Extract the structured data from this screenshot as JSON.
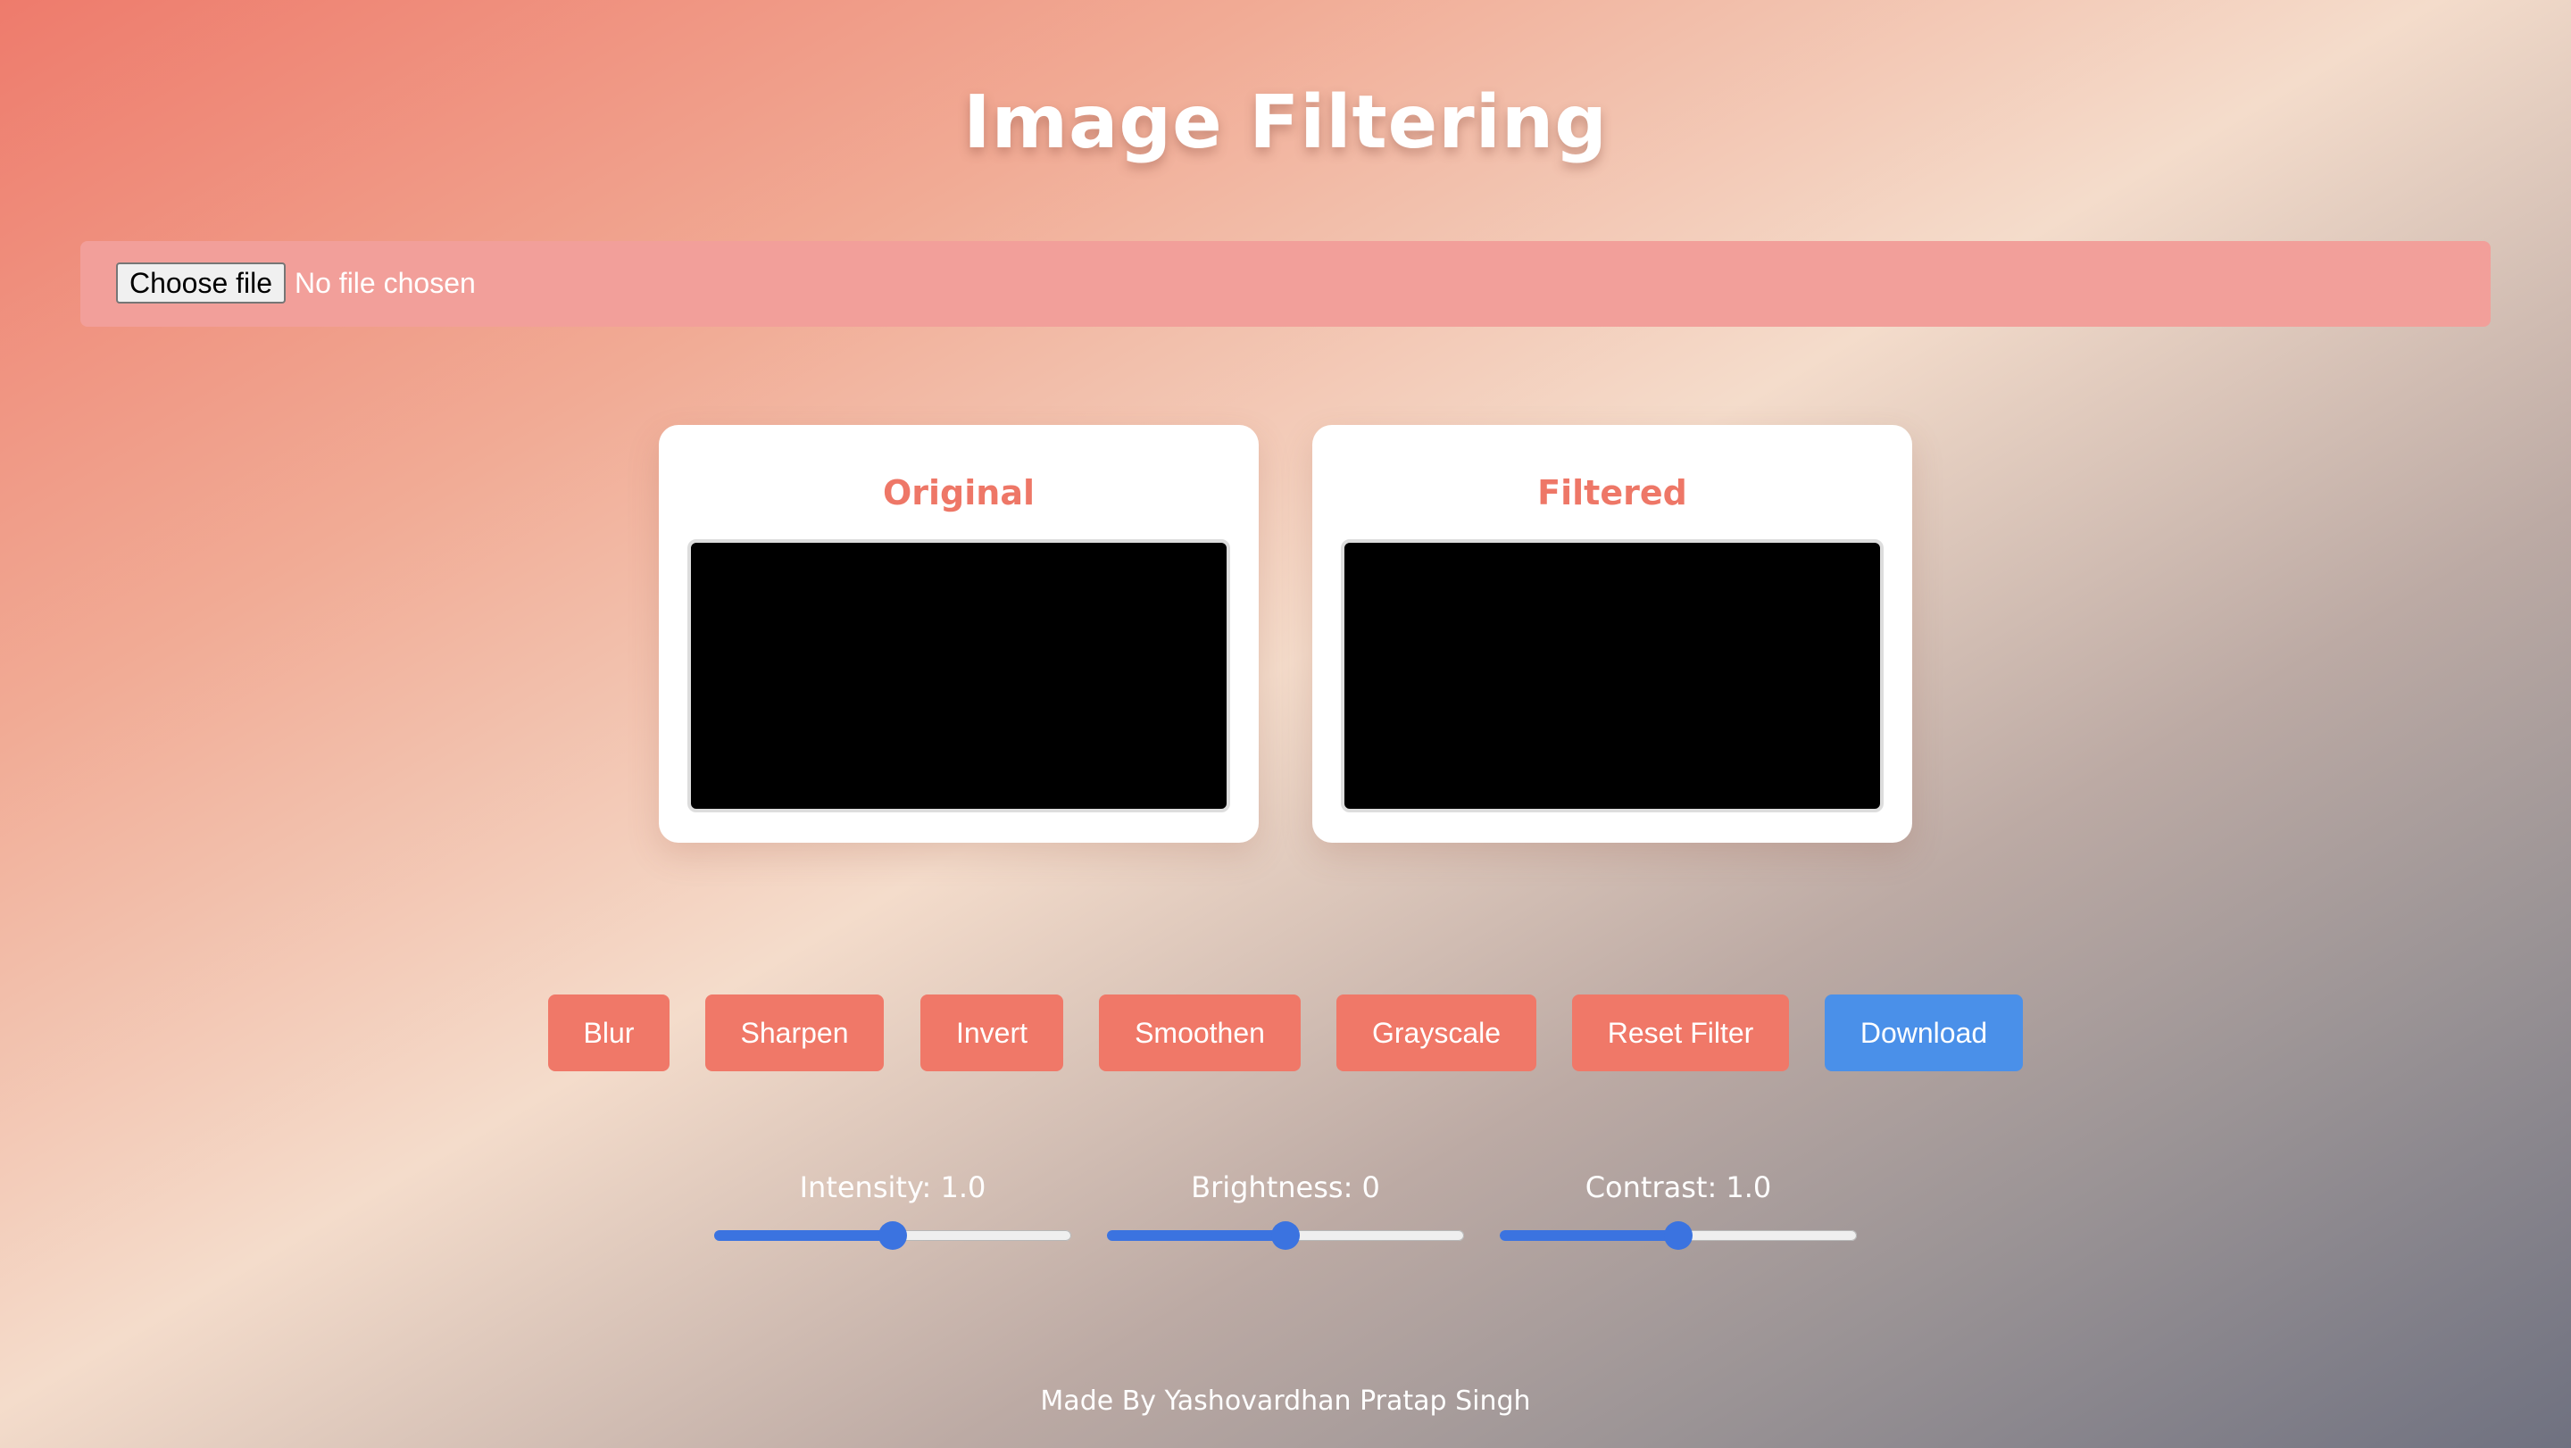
{
  "page_title": "Image Filtering",
  "file_input": {
    "button_label": "Choose file",
    "status_text": "No file chosen"
  },
  "panels": {
    "original": {
      "title": "Original"
    },
    "filtered": {
      "title": "Filtered"
    }
  },
  "buttons": [
    {
      "label": "Blur"
    },
    {
      "label": "Sharpen"
    },
    {
      "label": "Invert"
    },
    {
      "label": "Smoothen"
    },
    {
      "label": "Grayscale"
    },
    {
      "label": "Reset Filter"
    },
    {
      "label": "Download"
    }
  ],
  "sliders": [
    {
      "label": "Intensity: 1.0",
      "level": 0.5
    },
    {
      "label": "Brightness: 0",
      "level": 0.5
    },
    {
      "label": "Contrast: 1.0",
      "level": 0.5
    }
  ],
  "footer": {
    "text": "Made By Yashovardhan Pratap Singh"
  },
  "colors": {
    "filter_button": "#f07868",
    "download_button": "#4a90e9",
    "panel_title": "#ee7767",
    "slider_accent": "#3b73e0",
    "file_bar": "#f29f9a"
  }
}
